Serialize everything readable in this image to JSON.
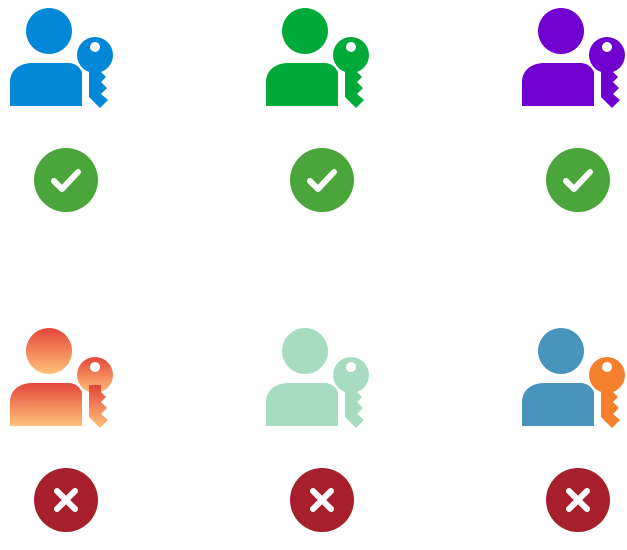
{
  "icons": [
    {
      "name": "user-key-blue",
      "fill": "#0288d6",
      "status": "valid"
    },
    {
      "name": "user-key-green",
      "fill": "#00aa3a",
      "status": "valid"
    },
    {
      "name": "user-key-purple",
      "fill": "#7000d0",
      "status": "valid"
    },
    {
      "name": "user-key-gradient",
      "fill_top": "#e4463a",
      "fill_bottom": "#ffc27a",
      "status": "invalid"
    },
    {
      "name": "user-key-mint",
      "fill": "#a8dcc0",
      "status": "invalid"
    },
    {
      "name": "user-key-two-tone",
      "user_fill": "#4894bc",
      "key_fill": "#f4802e",
      "status": "invalid"
    }
  ],
  "status_colors": {
    "valid": "#4aa63a",
    "invalid": "#a71e2c"
  },
  "status_icons": {
    "valid": "check-icon",
    "invalid": "x-icon"
  }
}
